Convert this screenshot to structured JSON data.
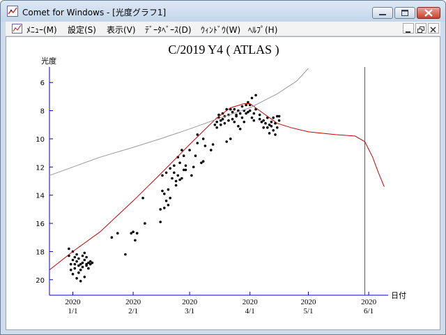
{
  "window": {
    "title": "Comet for Windows - [光度グラフ1]"
  },
  "menubar": {
    "items": [
      "ﾒﾆｭｰ(M)",
      "設定(S)",
      "表示(V)",
      "ﾃﾞｰﾀﾍﾞｰｽ(D)",
      "ｳｨﾝﾄﾞｳ(W)",
      "ﾍﾙﾌﾟ(H)"
    ]
  },
  "chart_data": {
    "type": "scatter",
    "title": "C/2019 Y4 ( ATLAS )",
    "ylabel": "光度",
    "xlabel": "日付",
    "y_inverted": true,
    "ylim": [
      4.9,
      21.1
    ],
    "y_ticks": [
      6,
      8,
      10,
      12,
      14,
      16,
      18,
      20
    ],
    "x_axis_unit": "date",
    "xlim": [
      "2019-12-20",
      "2020-06-11"
    ],
    "x_ticks": [
      {
        "date": "2020-01-01",
        "year": "2020",
        "md": "1/1"
      },
      {
        "date": "2020-02-01",
        "year": "2020",
        "md": "2/1"
      },
      {
        "date": "2020-03-01",
        "year": "2020",
        "md": "3/1"
      },
      {
        "date": "2020-04-01",
        "year": "2020",
        "md": "4/1"
      },
      {
        "date": "2020-05-01",
        "year": "2020",
        "md": "5/1"
      },
      {
        "date": "2020-06-01",
        "year": "2020",
        "md": "6/1"
      }
    ],
    "vertical_marker": {
      "date": "2020-05-30",
      "color": "#a020c0"
    },
    "series": [
      {
        "style": "points",
        "color": "#000000",
        "points": [
          [
            "2019-12-30",
            17.8
          ],
          [
            "2019-12-30",
            18.3
          ],
          [
            "2019-12-31",
            18.9
          ],
          [
            "2019-12-31",
            19.3
          ],
          [
            "2020-01-01",
            18.6
          ],
          [
            "2020-01-01",
            19.6
          ],
          [
            "2020-01-01",
            18.0
          ],
          [
            "2020-01-02",
            18.9
          ],
          [
            "2020-01-02",
            19.2
          ],
          [
            "2020-01-02",
            18.4
          ],
          [
            "2020-01-03",
            19.9
          ],
          [
            "2020-01-03",
            18.7
          ],
          [
            "2020-01-03",
            18.2
          ],
          [
            "2020-01-04",
            19.0
          ],
          [
            "2020-01-04",
            19.5
          ],
          [
            "2020-01-04",
            18.5
          ],
          [
            "2020-01-05",
            18.9
          ],
          [
            "2020-01-05",
            20.1
          ],
          [
            "2020-01-05",
            19.3
          ],
          [
            "2020-01-06",
            18.3
          ],
          [
            "2020-01-06",
            18.8
          ],
          [
            "2020-01-06",
            19.1
          ],
          [
            "2020-01-07",
            18.1
          ],
          [
            "2020-01-07",
            18.6
          ],
          [
            "2020-01-07",
            19.8
          ],
          [
            "2020-01-08",
            19.0
          ],
          [
            "2020-01-08",
            18.4
          ],
          [
            "2020-01-08",
            18.9
          ],
          [
            "2020-01-09",
            18.8
          ],
          [
            "2020-01-09",
            19.2
          ],
          [
            "2020-01-10",
            18.7
          ],
          [
            "2020-01-10",
            18.9
          ],
          [
            "2020-01-11",
            18.8
          ],
          [
            "2020-01-21",
            17.0
          ],
          [
            "2020-01-24",
            16.7
          ],
          [
            "2020-01-28",
            18.2
          ],
          [
            "2020-01-31",
            16.7
          ],
          [
            "2020-02-01",
            16.6
          ],
          [
            "2020-02-02",
            17.2
          ],
          [
            "2020-02-03",
            16.7
          ],
          [
            "2020-02-06",
            14.2
          ],
          [
            "2020-02-07",
            16.0
          ],
          [
            "2020-02-15",
            15.9
          ],
          [
            "2020-02-15",
            15.0
          ],
          [
            "2020-02-16",
            13.7
          ],
          [
            "2020-02-16",
            12.6
          ],
          [
            "2020-02-17",
            14.9
          ],
          [
            "2020-02-17",
            13.9
          ],
          [
            "2020-02-18",
            14.4
          ],
          [
            "2020-02-18",
            12.4
          ],
          [
            "2020-02-19",
            14.7
          ],
          [
            "2020-02-19",
            13.6
          ],
          [
            "2020-02-20",
            12.1
          ],
          [
            "2020-02-20",
            14.2
          ],
          [
            "2020-02-21",
            12.8
          ],
          [
            "2020-02-22",
            12.4
          ],
          [
            "2020-02-22",
            11.9
          ],
          [
            "2020-02-23",
            13.3
          ],
          [
            "2020-02-23",
            13.0
          ],
          [
            "2020-02-24",
            11.3
          ],
          [
            "2020-02-24",
            12.6
          ],
          [
            "2020-02-25",
            12.9
          ],
          [
            "2020-02-25",
            11.7
          ],
          [
            "2020-02-26",
            10.8
          ],
          [
            "2020-02-26",
            12.8
          ],
          [
            "2020-02-27",
            12.2
          ],
          [
            "2020-02-27",
            11.2
          ],
          [
            "2020-02-28",
            11.9
          ],
          [
            "2020-02-28",
            12.2
          ],
          [
            "2020-03-01",
            10.8
          ],
          [
            "2020-03-02",
            12.6
          ],
          [
            "2020-03-03",
            12.0
          ],
          [
            "2020-03-04",
            11.2
          ],
          [
            "2020-03-05",
            10.3
          ],
          [
            "2020-03-05",
            9.7
          ],
          [
            "2020-03-07",
            11.7
          ],
          [
            "2020-03-08",
            11.6
          ],
          [
            "2020-03-08",
            10.0
          ],
          [
            "2020-03-09",
            10.5
          ],
          [
            "2020-03-12",
            10.8
          ],
          [
            "2020-03-13",
            10.4
          ],
          [
            "2020-03-14",
            9.0
          ],
          [
            "2020-03-15",
            9.2
          ],
          [
            "2020-03-15",
            8.8
          ],
          [
            "2020-03-16",
            8.5
          ],
          [
            "2020-03-16",
            8.3
          ],
          [
            "2020-03-17",
            9.0
          ],
          [
            "2020-03-17",
            8.7
          ],
          [
            "2020-03-18",
            8.2
          ],
          [
            "2020-03-18",
            8.6
          ],
          [
            "2020-03-19",
            8.9
          ],
          [
            "2020-03-19",
            8.4
          ],
          [
            "2020-03-20",
            7.9
          ],
          [
            "2020-03-20",
            10.2
          ],
          [
            "2020-03-21",
            8.7
          ],
          [
            "2020-03-21",
            8.3
          ],
          [
            "2020-03-22",
            10.0
          ],
          [
            "2020-03-22",
            7.9
          ],
          [
            "2020-03-23",
            8.6
          ],
          [
            "2020-03-23",
            8.1
          ],
          [
            "2020-03-24",
            7.9
          ],
          [
            "2020-03-24",
            8.8
          ],
          [
            "2020-03-25",
            8.3
          ],
          [
            "2020-03-25",
            8.4
          ],
          [
            "2020-03-26",
            9.1
          ],
          [
            "2020-03-26",
            8.0
          ],
          [
            "2020-03-27",
            8.2
          ],
          [
            "2020-03-27",
            9.3
          ],
          [
            "2020-03-28",
            7.7
          ],
          [
            "2020-03-28",
            8.5
          ],
          [
            "2020-03-29",
            8.0
          ],
          [
            "2020-03-29",
            8.8
          ],
          [
            "2020-03-30",
            7.6
          ],
          [
            "2020-03-30",
            8.2
          ],
          [
            "2020-03-31",
            7.4
          ],
          [
            "2020-03-31",
            8.1
          ],
          [
            "2020-04-01",
            7.6
          ],
          [
            "2020-04-01",
            8.0
          ],
          [
            "2020-04-02",
            8.5
          ],
          [
            "2020-04-02",
            7.1
          ],
          [
            "2020-04-03",
            8.2
          ],
          [
            "2020-04-03",
            8.7
          ],
          [
            "2020-04-04",
            6.9
          ],
          [
            "2020-04-04",
            7.9
          ],
          [
            "2020-04-06",
            8.6
          ],
          [
            "2020-04-06",
            8.3
          ],
          [
            "2020-04-07",
            8.8
          ],
          [
            "2020-04-08",
            9.2
          ],
          [
            "2020-04-08",
            8.7
          ],
          [
            "2020-04-09",
            8.9
          ],
          [
            "2020-04-10",
            8.5
          ],
          [
            "2020-04-10",
            9.2
          ],
          [
            "2020-04-11",
            9.0
          ],
          [
            "2020-04-11",
            9.6
          ],
          [
            "2020-04-12",
            9.1
          ],
          [
            "2020-04-12",
            8.8
          ],
          [
            "2020-04-13",
            9.4
          ],
          [
            "2020-04-13",
            8.5
          ],
          [
            "2020-04-14",
            8.9
          ],
          [
            "2020-04-14",
            9.7
          ],
          [
            "2020-04-15",
            8.4
          ],
          [
            "2020-04-15",
            9.2
          ],
          [
            "2020-04-16",
            8.7
          ],
          [
            "2020-04-16",
            8.4
          ]
        ]
      },
      {
        "style": "line",
        "color": "#c80000",
        "points": [
          [
            "2019-12-20",
            19.3
          ],
          [
            "2020-01-01",
            18.0
          ],
          [
            "2020-01-15",
            16.6
          ],
          [
            "2020-02-01",
            14.4
          ],
          [
            "2020-02-15",
            12.5
          ],
          [
            "2020-03-01",
            10.4
          ],
          [
            "2020-03-15",
            8.5
          ],
          [
            "2020-03-22",
            7.8
          ],
          [
            "2020-03-29",
            7.5
          ],
          [
            "2020-04-01",
            7.5
          ],
          [
            "2020-04-07",
            8.1
          ],
          [
            "2020-04-15",
            8.9
          ],
          [
            "2020-04-22",
            9.2
          ],
          [
            "2020-05-01",
            9.5
          ],
          [
            "2020-05-15",
            9.7
          ],
          [
            "2020-05-25",
            9.8
          ],
          [
            "2020-05-30",
            10.2
          ],
          [
            "2020-06-03",
            11.3
          ],
          [
            "2020-06-06",
            12.4
          ],
          [
            "2020-06-09",
            13.4
          ]
        ]
      },
      {
        "style": "line",
        "color": "#9a9a9a",
        "points": [
          [
            "2019-12-20",
            12.6
          ],
          [
            "2020-01-01",
            12.0
          ],
          [
            "2020-01-15",
            11.3
          ],
          [
            "2020-02-01",
            10.6
          ],
          [
            "2020-02-15",
            10.0
          ],
          [
            "2020-03-01",
            9.3
          ],
          [
            "2020-03-15",
            8.6
          ],
          [
            "2020-04-01",
            7.8
          ],
          [
            "2020-04-15",
            6.8
          ],
          [
            "2020-04-25",
            5.9
          ],
          [
            "2020-05-01",
            5.0
          ]
        ]
      }
    ]
  }
}
